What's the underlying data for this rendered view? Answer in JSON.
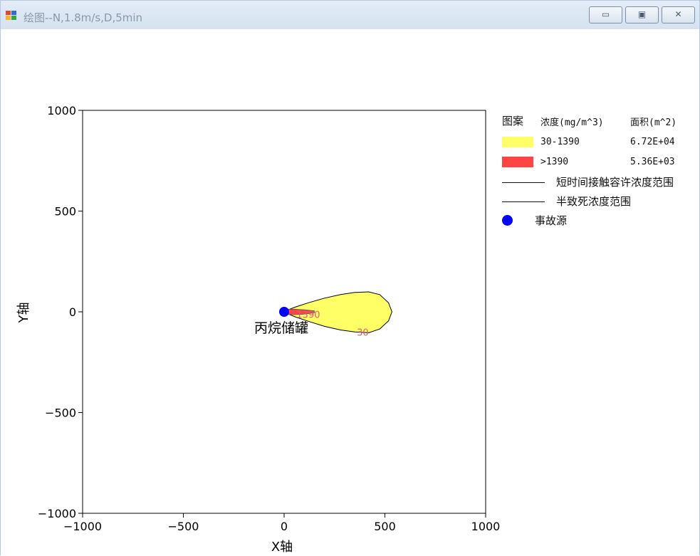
{
  "window": {
    "title": "绘图--N,1.8m/s,D,5min",
    "controls": {
      "minimize": "▭",
      "maximize": "▣",
      "close": "✕"
    }
  },
  "colors": {
    "low_zone": "#ffff66",
    "high_zone": "#ff4444",
    "source": "#0000ff",
    "axis": "#000000"
  },
  "chart_data": {
    "type": "area",
    "xlabel": "X轴",
    "ylabel": "Y轴",
    "xlim": [
      -1000,
      1000
    ],
    "ylim": [
      -1000,
      1000
    ],
    "xticks": [
      -1000,
      -500,
      0,
      500,
      1000
    ],
    "yticks": [
      -1000,
      -500,
      0,
      500,
      1000
    ],
    "xtick_labels": [
      "−1000",
      "−500",
      "0",
      "500",
      "1000"
    ],
    "ytick_labels": [
      "−1000",
      "−500",
      "0",
      "500",
      "1000"
    ],
    "grid": false,
    "legend_placement": "right",
    "source": {
      "name": "事故源",
      "label": "丙烷储罐",
      "x": 0,
      "y": 0
    },
    "zones": [
      {
        "name": "30-1390",
        "contour_label": "30",
        "contour_label_at": [
          390,
          -100
        ],
        "outline": [
          [
            0,
            3
          ],
          [
            60,
            25
          ],
          [
            120,
            45
          ],
          [
            200,
            68
          ],
          [
            280,
            86
          ],
          [
            350,
            96
          ],
          [
            420,
            99
          ],
          [
            475,
            85
          ],
          [
            518,
            45
          ],
          [
            535,
            0
          ],
          [
            518,
            -45
          ],
          [
            475,
            -85
          ],
          [
            420,
            -104
          ],
          [
            350,
            -100
          ],
          [
            280,
            -90
          ],
          [
            200,
            -72
          ],
          [
            120,
            -47
          ],
          [
            60,
            -27
          ],
          [
            0,
            -3
          ]
        ]
      },
      {
        "name": ">1390",
        "contour_label": "1390",
        "contour_label_at": [
          120,
          -12
        ],
        "outline": [
          [
            0,
            13
          ],
          [
            50,
            13
          ],
          [
            100,
            10
          ],
          [
            150,
            5
          ],
          [
            150,
            -5
          ],
          [
            100,
            -12
          ],
          [
            50,
            -14
          ],
          [
            0,
            -13
          ]
        ]
      }
    ],
    "legend": {
      "header": {
        "pattern": "图案",
        "concentration": "浓度(mg/m^3)",
        "area": "面积(m^2)"
      },
      "rows": [
        {
          "range": "30-1390",
          "area": "6.72E+04"
        },
        {
          "range": ">1390",
          "area": "5.36E+03"
        }
      ],
      "lines": [
        "短时间接触容许浓度范围",
        "半致死浓度范围"
      ],
      "source_entry": "事故源"
    }
  }
}
